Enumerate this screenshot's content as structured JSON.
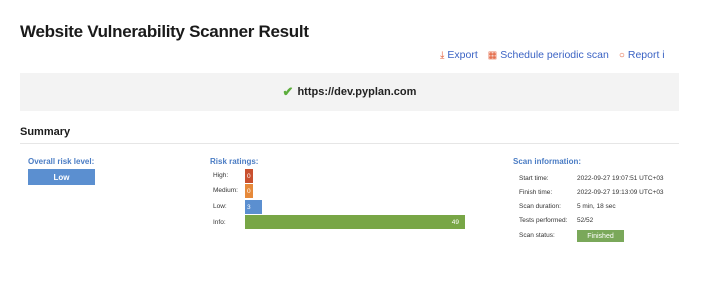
{
  "page": {
    "title": "Website Vulnerability Scanner Result"
  },
  "toolbar": {
    "export_label": "Export",
    "schedule_label": "Schedule periodic scan",
    "report_label": "Report i"
  },
  "target": {
    "url": "https://dev.pyplan.com"
  },
  "summary": {
    "title": "Summary",
    "overall": {
      "label": "Overall risk level:",
      "value": "Low"
    },
    "risk": {
      "label": "Risk ratings:",
      "items": [
        {
          "label": "High:",
          "value": 0,
          "color": "#c9502f"
        },
        {
          "label": "Medium:",
          "value": 0,
          "color": "#e6893a"
        },
        {
          "label": "Low:",
          "value": 3,
          "color": "#5b8fd0"
        },
        {
          "label": "Info:",
          "value": 49,
          "color": "#78a646"
        }
      ]
    },
    "scan": {
      "label": "Scan information:",
      "start_label": "Start time:",
      "start_value": "2022-09-27 19:07:51 UTC+03",
      "finish_label": "Finish time:",
      "finish_value": "2022-09-27 19:13:09 UTC+03",
      "duration_label": "Scan duration:",
      "duration_value": "5 min, 18 sec",
      "tests_label": "Tests performed:",
      "tests_value": "52/52",
      "status_label": "Scan status:",
      "status_value": "Finished"
    }
  },
  "colors": {
    "accent": "#4a7cc4",
    "check": "#5cad3c",
    "finished": "#7aa85a",
    "icon": "#e0562f"
  },
  "icons": {
    "export": "download-icon",
    "schedule": "calendar-icon",
    "report": "chat-bubble-icon",
    "target": "checkmark-icon"
  }
}
